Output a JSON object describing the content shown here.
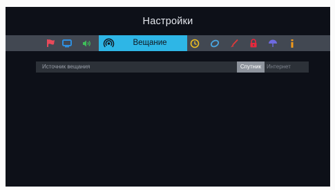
{
  "header": {
    "title": "Настройки"
  },
  "menu": {
    "icons": [
      "flag-icon",
      "monitor-icon",
      "sound-icon",
      "broadcast-icon",
      "clock-icon",
      "ring-icon",
      "brush-icon",
      "lock-icon",
      "umbrella-icon",
      "info-icon"
    ],
    "active_label": "Вещание"
  },
  "broadcast_source": {
    "label": "Источник вещания",
    "options": [
      "Спутник",
      "Интернет"
    ],
    "selected": "Спутник"
  },
  "colors": {
    "background": "#0d1018",
    "menu_bar": "#424852",
    "active_tab": "#2eb6e6",
    "flag": "#e84a5a",
    "monitor": "#2f8fe0",
    "sound": "#3fbf5a",
    "clock": "#f0c020",
    "ring": "#4aa6e0",
    "brush": "#e03a3a",
    "lock": "#e8283c",
    "umbrella": "#6e6ae0",
    "info": "#f29a1a",
    "selected_option": "#8e949d"
  }
}
